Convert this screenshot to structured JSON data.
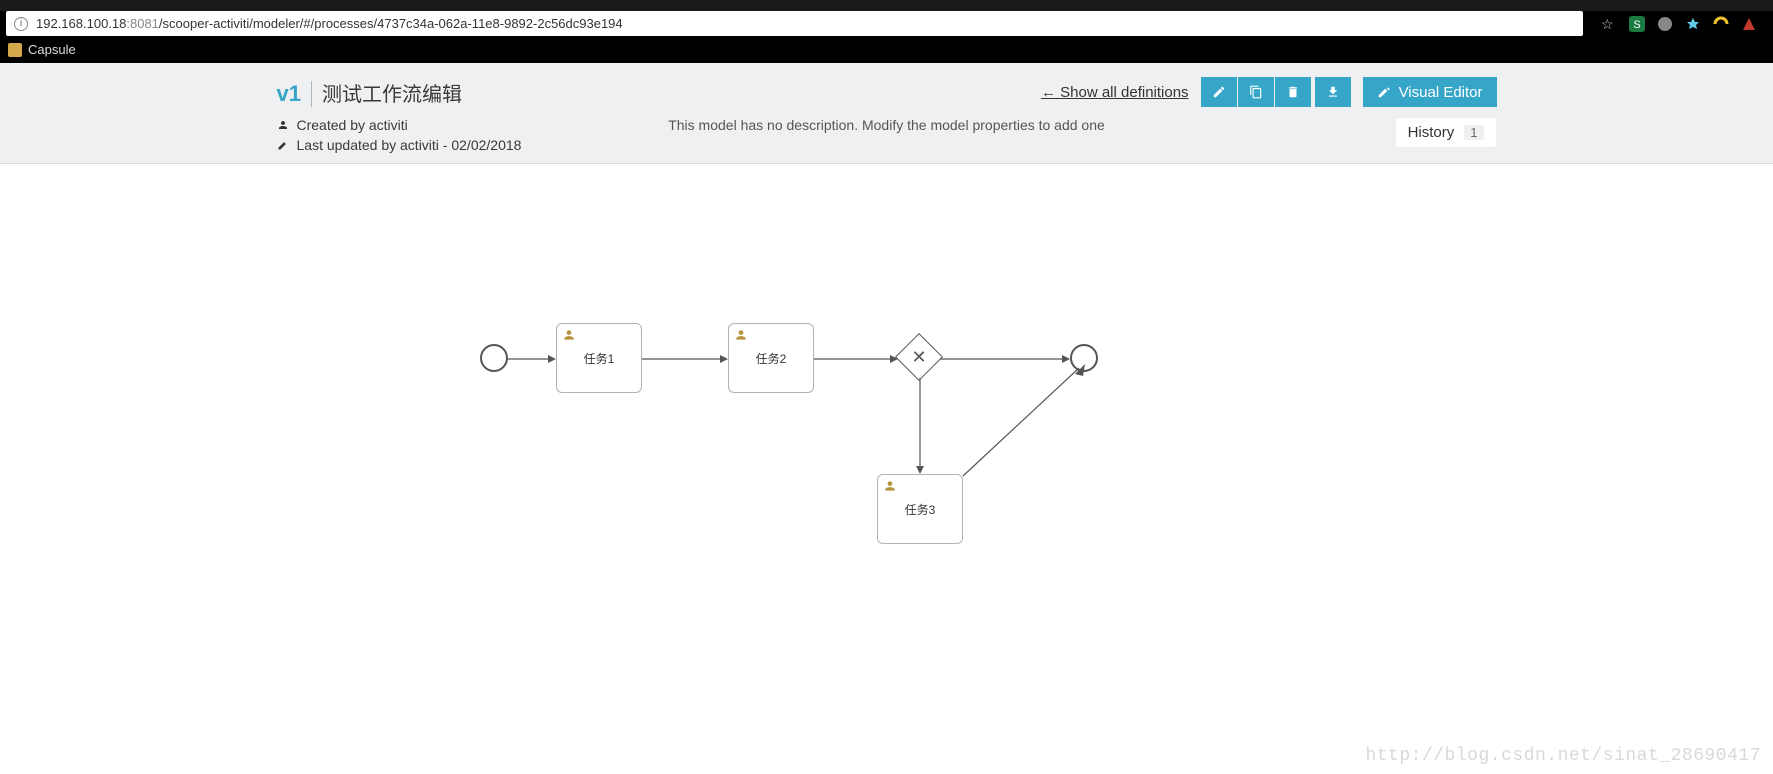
{
  "browser": {
    "url_host": "192.168.100.18",
    "url_port": ":8081",
    "url_path": "/scooper-activiti/modeler/#/processes/4737c34a-062a-11e8-9892-2c56dc93e194",
    "bookmark": "Capsule"
  },
  "header": {
    "version": "v1",
    "title": "测试工作流编辑",
    "show_all_label": "Show all definitions",
    "visual_editor_label": "Visual Editor",
    "created_by": "Created by activiti",
    "last_updated": "Last updated by activiti - 02/02/2018",
    "description_placeholder": "This model has no description. Modify the model properties to add one",
    "history_label": "History",
    "history_count": "1"
  },
  "diagram": {
    "task1_label": "任务1",
    "task2_label": "任务2",
    "task3_label": "任务3"
  },
  "watermark": "http://blog.csdn.net/sinat_28690417"
}
